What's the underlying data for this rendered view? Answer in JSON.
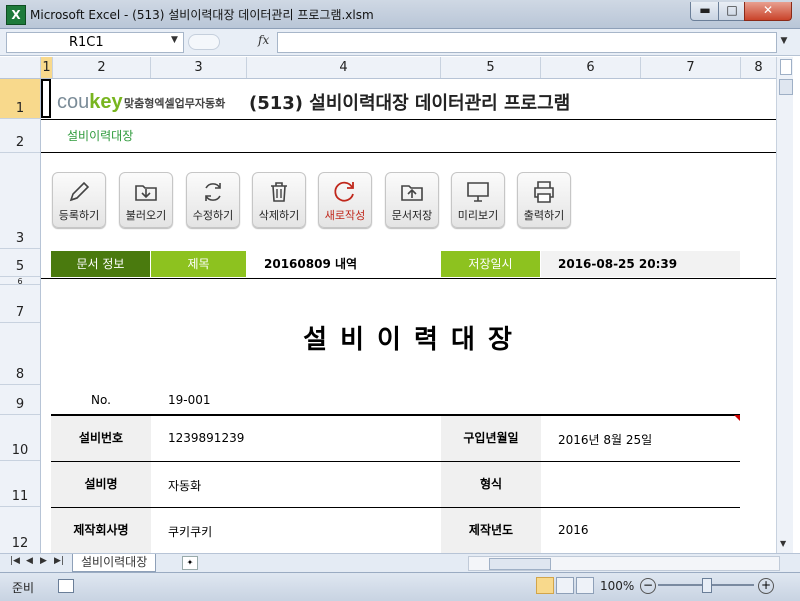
{
  "window": {
    "app_icon": "X",
    "title": "Microsoft Excel - (513) 설비이력대장 데이터관리 프로그램.xlsm",
    "min_icon": "minimize-icon",
    "max_icon": "maximize-icon",
    "close_icon": "close-icon"
  },
  "formula_bar": {
    "name_box": "R1C1",
    "fx_label": "fx",
    "formula": ""
  },
  "columns": [
    "1",
    "2",
    "3",
    "4",
    "5",
    "6",
    "7",
    "8"
  ],
  "rows": [
    "1",
    "2",
    "3",
    "5",
    "6",
    "7",
    "8",
    "9",
    "10",
    "11",
    "12"
  ],
  "sheet": {
    "logo_prefix": "cou",
    "logo_suffix": "key",
    "logo_tagline": "맞춤형엑셀업무자동화",
    "title": "(513) 설비이력대장 데이터관리 프로그램",
    "sheet_label": "설비이력대장",
    "toolbar": [
      {
        "label": "등록하기",
        "icon": "pencil-icon"
      },
      {
        "label": "불러오기",
        "icon": "folder-download-icon"
      },
      {
        "label": "수정하기",
        "icon": "refresh-icon"
      },
      {
        "label": "삭제하기",
        "icon": "trash-icon"
      },
      {
        "label": "새로작성",
        "icon": "new-refresh-icon"
      },
      {
        "label": "문서저장",
        "icon": "folder-upload-icon"
      },
      {
        "label": "미리보기",
        "icon": "monitor-icon"
      },
      {
        "label": "출력하기",
        "icon": "printer-icon"
      }
    ],
    "doc_info": {
      "section_label": "문서 정보",
      "title_label": "제목",
      "title_value": "20160809 내역",
      "saved_label": "저장일시",
      "saved_value": "2016-08-25 20:39"
    },
    "form_title": "설 비 이 력 대 장",
    "no_label": "No.",
    "no_value": "19-001",
    "fields": {
      "equip_no_label": "설비번호",
      "equip_no_value": "1239891239",
      "purchase_label": "구입년월일",
      "purchase_value": "2016년 8월 25일",
      "equip_name_label": "설비명",
      "equip_name_value": "자동화",
      "type_label": "형식",
      "type_value": "",
      "maker_label": "제작회사명",
      "maker_value": "쿠키쿠키",
      "year_label": "제작년도",
      "year_value": "2016"
    }
  },
  "tabs": {
    "active_sheet": "설비이력대장"
  },
  "status": {
    "ready": "준비",
    "zoom": "100%"
  },
  "colors": {
    "dark_green": "#4a7a0e",
    "light_green": "#8dc21f",
    "accent_red": "#c0271b"
  }
}
